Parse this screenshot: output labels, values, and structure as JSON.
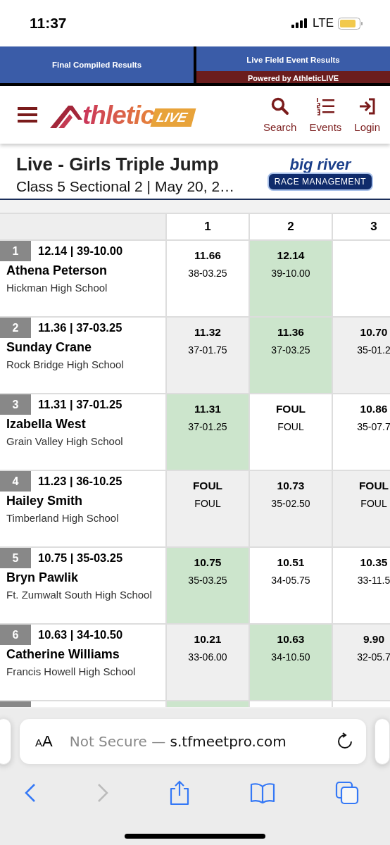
{
  "status_bar": {
    "time": "11:37",
    "network": "LTE"
  },
  "top_tabs": [
    {
      "label": "Final Compiled Results",
      "selected": false
    },
    {
      "label": "Live Field Event Results",
      "selected": true,
      "sub_label": "Powered by AthleticLIVE"
    }
  ],
  "header": {
    "logo": {
      "text": "thletic",
      "badge": "LIVE"
    },
    "actions": [
      {
        "kind": "search",
        "label": "Search"
      },
      {
        "kind": "events",
        "label": "Events"
      },
      {
        "kind": "login",
        "label": "Login"
      }
    ]
  },
  "event": {
    "title": "Live - Girls Triple Jump",
    "subtitle": "Class 5 Sectional 2 | May 20, 2…",
    "sponsor": {
      "top": "big river",
      "bottom": "RACE MANAGEMENT"
    }
  },
  "table": {
    "columns": [
      "1",
      "2",
      "3"
    ],
    "rows": [
      {
        "place": "1",
        "best": "12.14 | 39-10.00",
        "name": "Athena Peterson",
        "school": "Hickman High School",
        "attempts": [
          {
            "mark": "11.66",
            "imperial": "38-03.25",
            "best": false
          },
          {
            "mark": "12.14",
            "imperial": "39-10.00",
            "best": true
          }
        ]
      },
      {
        "place": "2",
        "best": "11.36 | 37-03.25",
        "name": "Sunday Crane",
        "school": "Rock Bridge High School",
        "attempts": [
          {
            "mark": "11.32",
            "imperial": "37-01.75",
            "best": false
          },
          {
            "mark": "11.36",
            "imperial": "37-03.25",
            "best": true
          },
          {
            "mark": "10.70",
            "imperial": "35-01.2",
            "best": false
          }
        ]
      },
      {
        "place": "3",
        "best": "11.31 | 37-01.25",
        "name": "Izabella West",
        "school": "Grain Valley High School",
        "attempts": [
          {
            "mark": "11.31",
            "imperial": "37-01.25",
            "best": true
          },
          {
            "mark": "FOUL",
            "imperial": "FOUL",
            "best": false
          },
          {
            "mark": "10.86",
            "imperial": "35-07.7",
            "best": false
          }
        ]
      },
      {
        "place": "4",
        "best": "11.23 | 36-10.25",
        "name": "Hailey Smith",
        "school": "Timberland High School",
        "attempts": [
          {
            "mark": "FOUL",
            "imperial": "FOUL",
            "best": false
          },
          {
            "mark": "10.73",
            "imperial": "35-02.50",
            "best": false
          },
          {
            "mark": "FOUL",
            "imperial": "FOUL",
            "best": false
          }
        ]
      },
      {
        "place": "5",
        "best": "10.75 | 35-03.25",
        "name": "Bryn Pawlik",
        "school": "Ft. Zumwalt South High School",
        "attempts": [
          {
            "mark": "10.75",
            "imperial": "35-03.25",
            "best": true
          },
          {
            "mark": "10.51",
            "imperial": "34-05.75",
            "best": false
          },
          {
            "mark": "10.35",
            "imperial": "33-11.5",
            "best": false
          }
        ]
      },
      {
        "place": "6",
        "best": "10.63 | 34-10.50",
        "name": "Catherine Williams",
        "school": "Francis Howell High School",
        "attempts": [
          {
            "mark": "10.21",
            "imperial": "33-06.00",
            "best": false
          },
          {
            "mark": "10.63",
            "imperial": "34-10.50",
            "best": true
          },
          {
            "mark": "9.90",
            "imperial": "32-05.7",
            "best": false
          }
        ]
      }
    ]
  },
  "browser": {
    "text_size": {
      "small": "A",
      "large": "A"
    },
    "address": {
      "prefix": "Not Secure — ",
      "host": "s.tfmeetpro.com"
    },
    "forward_disabled": true
  }
}
